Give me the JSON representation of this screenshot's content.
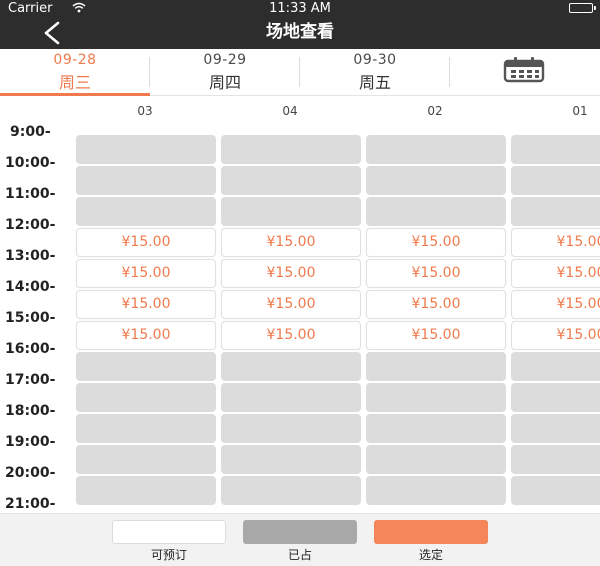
{
  "status_bar": {
    "carrier": "Carrier",
    "time": "11:33 AM"
  },
  "nav": {
    "title": "场地查看",
    "back_icon": "chevron-left-icon"
  },
  "dates": [
    {
      "date": "09-28",
      "weekday": "周三",
      "active": true
    },
    {
      "date": "09-29",
      "weekday": "周四",
      "active": false
    },
    {
      "date": "09-30",
      "weekday": "周五",
      "active": false
    }
  ],
  "calendar_icon": "calendar-icon",
  "courts": [
    "03",
    "04",
    "02",
    "01"
  ],
  "times": [
    "9:00-",
    "10:00-",
    "11:00-",
    "12:00-",
    "13:00-",
    "14:00-",
    "15:00-",
    "16:00-",
    "17:00-",
    "18:00-",
    "19:00-",
    "20:00-",
    "21:00-"
  ],
  "slots": [
    [
      "booked",
      "booked",
      "booked",
      "booked"
    ],
    [
      "booked",
      "booked",
      "booked",
      "booked"
    ],
    [
      "booked",
      "booked",
      "booked",
      "booked"
    ],
    [
      "avail",
      "avail",
      "avail",
      "avail"
    ],
    [
      "avail",
      "avail",
      "avail",
      "avail"
    ],
    [
      "avail",
      "avail",
      "avail",
      "avail"
    ],
    [
      "avail",
      "avail",
      "avail",
      "avail"
    ],
    [
      "booked",
      "booked",
      "booked",
      "booked"
    ],
    [
      "booked",
      "booked",
      "booked",
      "booked"
    ],
    [
      "booked",
      "booked",
      "booked",
      "booked"
    ],
    [
      "booked",
      "booked",
      "booked",
      "booked"
    ],
    [
      "booked",
      "booked",
      "booked",
      "booked"
    ]
  ],
  "price": "¥15.00",
  "legend": [
    {
      "label": "可预订",
      "color": "#ffffff"
    },
    {
      "label": "已占",
      "color": "#a8a8a8"
    },
    {
      "label": "选定",
      "color": "#f5855a"
    }
  ],
  "colors": {
    "accent": "#f07a4d",
    "booked": "#dcdcdc",
    "navbar": "#2d2d2d"
  }
}
